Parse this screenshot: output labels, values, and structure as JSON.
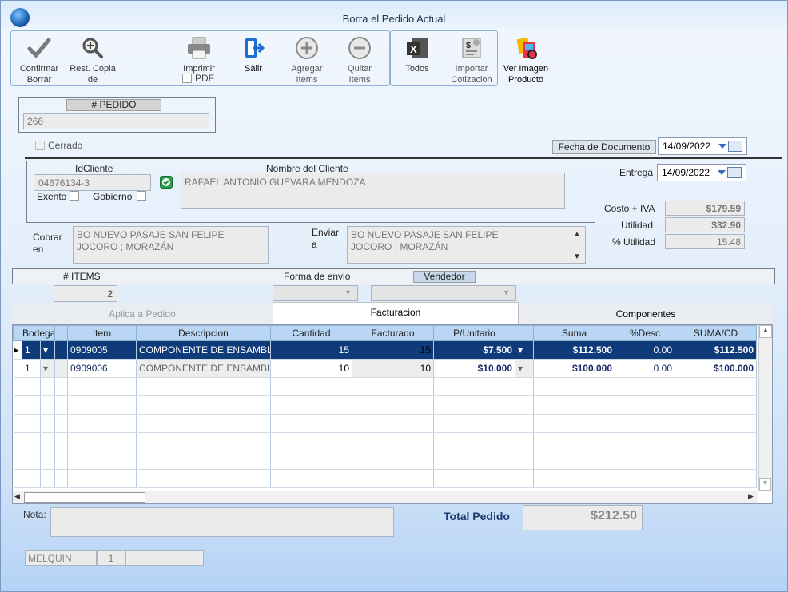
{
  "window": {
    "title": "Borra el Pedido Actual"
  },
  "toolbar": {
    "confirmar": "Confirmar\nBorrar",
    "rest_copia": "Rest. Copia\nde",
    "imprimir": "Imprimir",
    "pdf": "PDF",
    "salir": "Salir",
    "agregar": "Agregar\nItems",
    "quitar": "Quitar\nItems",
    "todos": "Todos",
    "importar": "Importar\nCotizacion",
    "ver_imagen": "Ver Imagen\nProducto"
  },
  "pedido": {
    "label": "# PEDIDO",
    "value": "266"
  },
  "cerrado": {
    "label": "Cerrado"
  },
  "fecha_doc": {
    "label": "Fecha de  Documento",
    "value": "14/09/2022"
  },
  "entrega": {
    "label": "Entrega",
    "value": "14/09/2022"
  },
  "cliente": {
    "id_label": "IdCliente",
    "id_value": "04676134-3",
    "nombre_label": "Nombre del Cliente",
    "nombre_value": "RAFAEL ANTONIO GUEVARA MENDOZA",
    "exento": "Exento",
    "gobierno": "Gobierno"
  },
  "totales": {
    "costo_label": "Costo + IVA",
    "costo_value": "$179.59",
    "utilidad_label": "Utilidad",
    "utilidad_value": "$32.90",
    "putil_label": "% Utilidad",
    "putil_value": "15.48"
  },
  "cobrar": {
    "label_1": "Cobrar",
    "label_2": "en",
    "line1": "BO NUEVO PASAJE SAN FELIPE",
    "line2": "JOCORO ; MORAZÁN"
  },
  "enviar": {
    "label_1": "Enviar",
    "label_2": "a",
    "line1": "BO NUEVO PASAJE SAN FELIPE",
    "line2": "JOCORO ; MORAZÁN"
  },
  "summary": {
    "items_label": "# ITEMS",
    "items_value": "2",
    "forma_envio_label": "Forma de envio",
    "vendedor_label": "Vendedor",
    "vendedor_value": "."
  },
  "tabs": {
    "aplica": "Aplica a Pedido",
    "facturacion": "Facturacion",
    "componentes": "Componentes"
  },
  "grid": {
    "headers": {
      "bodega": "Bodega",
      "item": "Item",
      "descripcion": "Descripcion",
      "cantidad": "Cantidad",
      "facturado": "Facturado",
      "punitario": "P/Unitario",
      "suma": "Suma",
      "desc": "%Desc",
      "sumacd": "SUMA/CD"
    },
    "rows": [
      {
        "bodega": "1",
        "item": "0909005",
        "descripcion": "COMPONENTE DE ENSAMBL",
        "cantidad": "15",
        "facturado": "15",
        "punitario": "$7.500",
        "suma": "$112.500",
        "desc": "0.00",
        "sumacd": "$112.500"
      },
      {
        "bodega": "1",
        "item": "0909006",
        "descripcion": "COMPONENTE DE ENSAMBL",
        "cantidad": "10",
        "facturado": "10",
        "punitario": "$10.000",
        "suma": "$100.000",
        "desc": "0.00",
        "sumacd": "$100.000"
      }
    ]
  },
  "footer": {
    "nota_label": "Nota:",
    "total_label": "Total Pedido",
    "total_value": "$212.50",
    "user": "MELQUIN",
    "user_num": "1"
  }
}
